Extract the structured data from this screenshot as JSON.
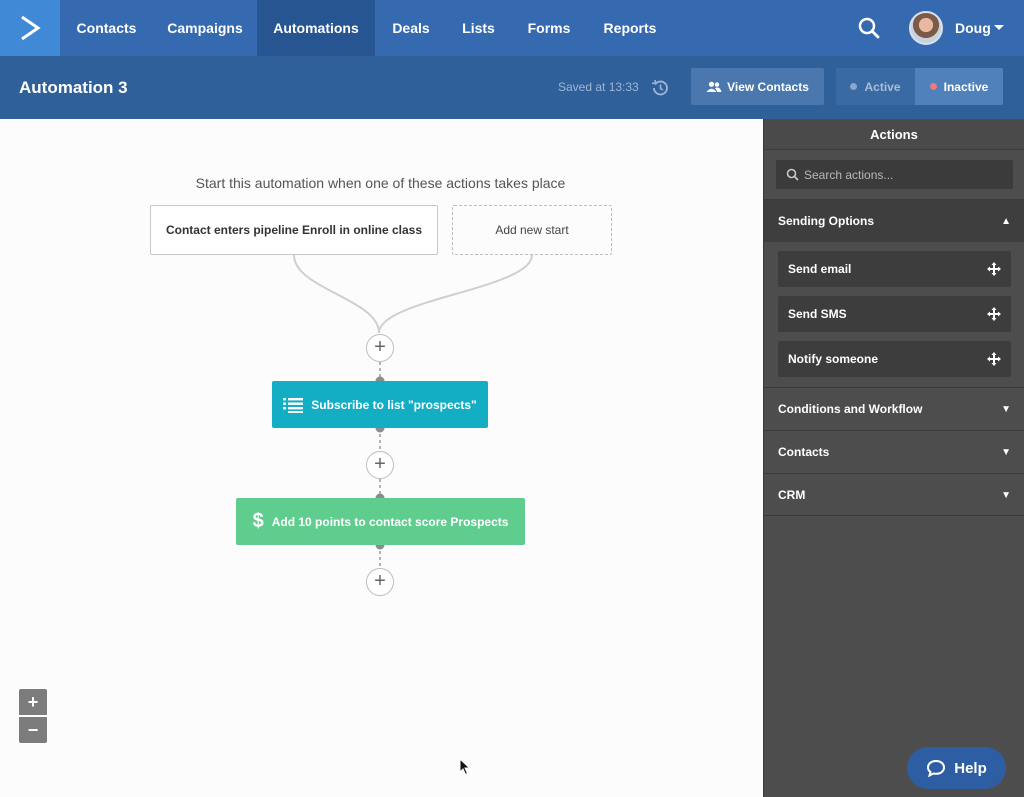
{
  "nav": {
    "items": [
      {
        "label": "Contacts"
      },
      {
        "label": "Campaigns"
      },
      {
        "label": "Automations"
      },
      {
        "label": "Deals"
      },
      {
        "label": "Lists"
      },
      {
        "label": "Forms"
      },
      {
        "label": "Reports"
      }
    ],
    "active": "Automations",
    "user_name": "Doug",
    "brand_color": "#356ab0"
  },
  "header": {
    "title": "Automation 3",
    "saved_text": "Saved at 13:33",
    "view_contacts_label": "View Contacts",
    "status": {
      "active_label": "Active",
      "inactive_label": "Inactive",
      "selected": "Inactive",
      "active_dot_color": "#8aa7c9",
      "inactive_dot_color": "#f07a7a"
    }
  },
  "canvas": {
    "start_heading": "Start this automation when one of these actions takes place",
    "start_trigger": "Contact enters pipeline Enroll in online class",
    "add_start_label": "Add new start",
    "actions": [
      {
        "label": "Subscribe to list \"prospects\"",
        "icon": "list-icon",
        "color": "#13aec4"
      },
      {
        "label": "Add 10 points to contact score Prospects",
        "icon": "dollar-icon",
        "color": "#5ecd8e"
      }
    ],
    "zoom_in": "+",
    "zoom_out": "−"
  },
  "sidebar": {
    "title": "Actions",
    "search_placeholder": "Search actions...",
    "sections": [
      {
        "label": "Sending Options",
        "expanded": true,
        "items": [
          {
            "label": "Send email"
          },
          {
            "label": "Send SMS"
          },
          {
            "label": "Notify someone"
          }
        ]
      },
      {
        "label": "Conditions and Workflow",
        "expanded": false
      },
      {
        "label": "Contacts",
        "expanded": false
      },
      {
        "label": "CRM",
        "expanded": false
      }
    ]
  },
  "help": {
    "label": "Help"
  }
}
